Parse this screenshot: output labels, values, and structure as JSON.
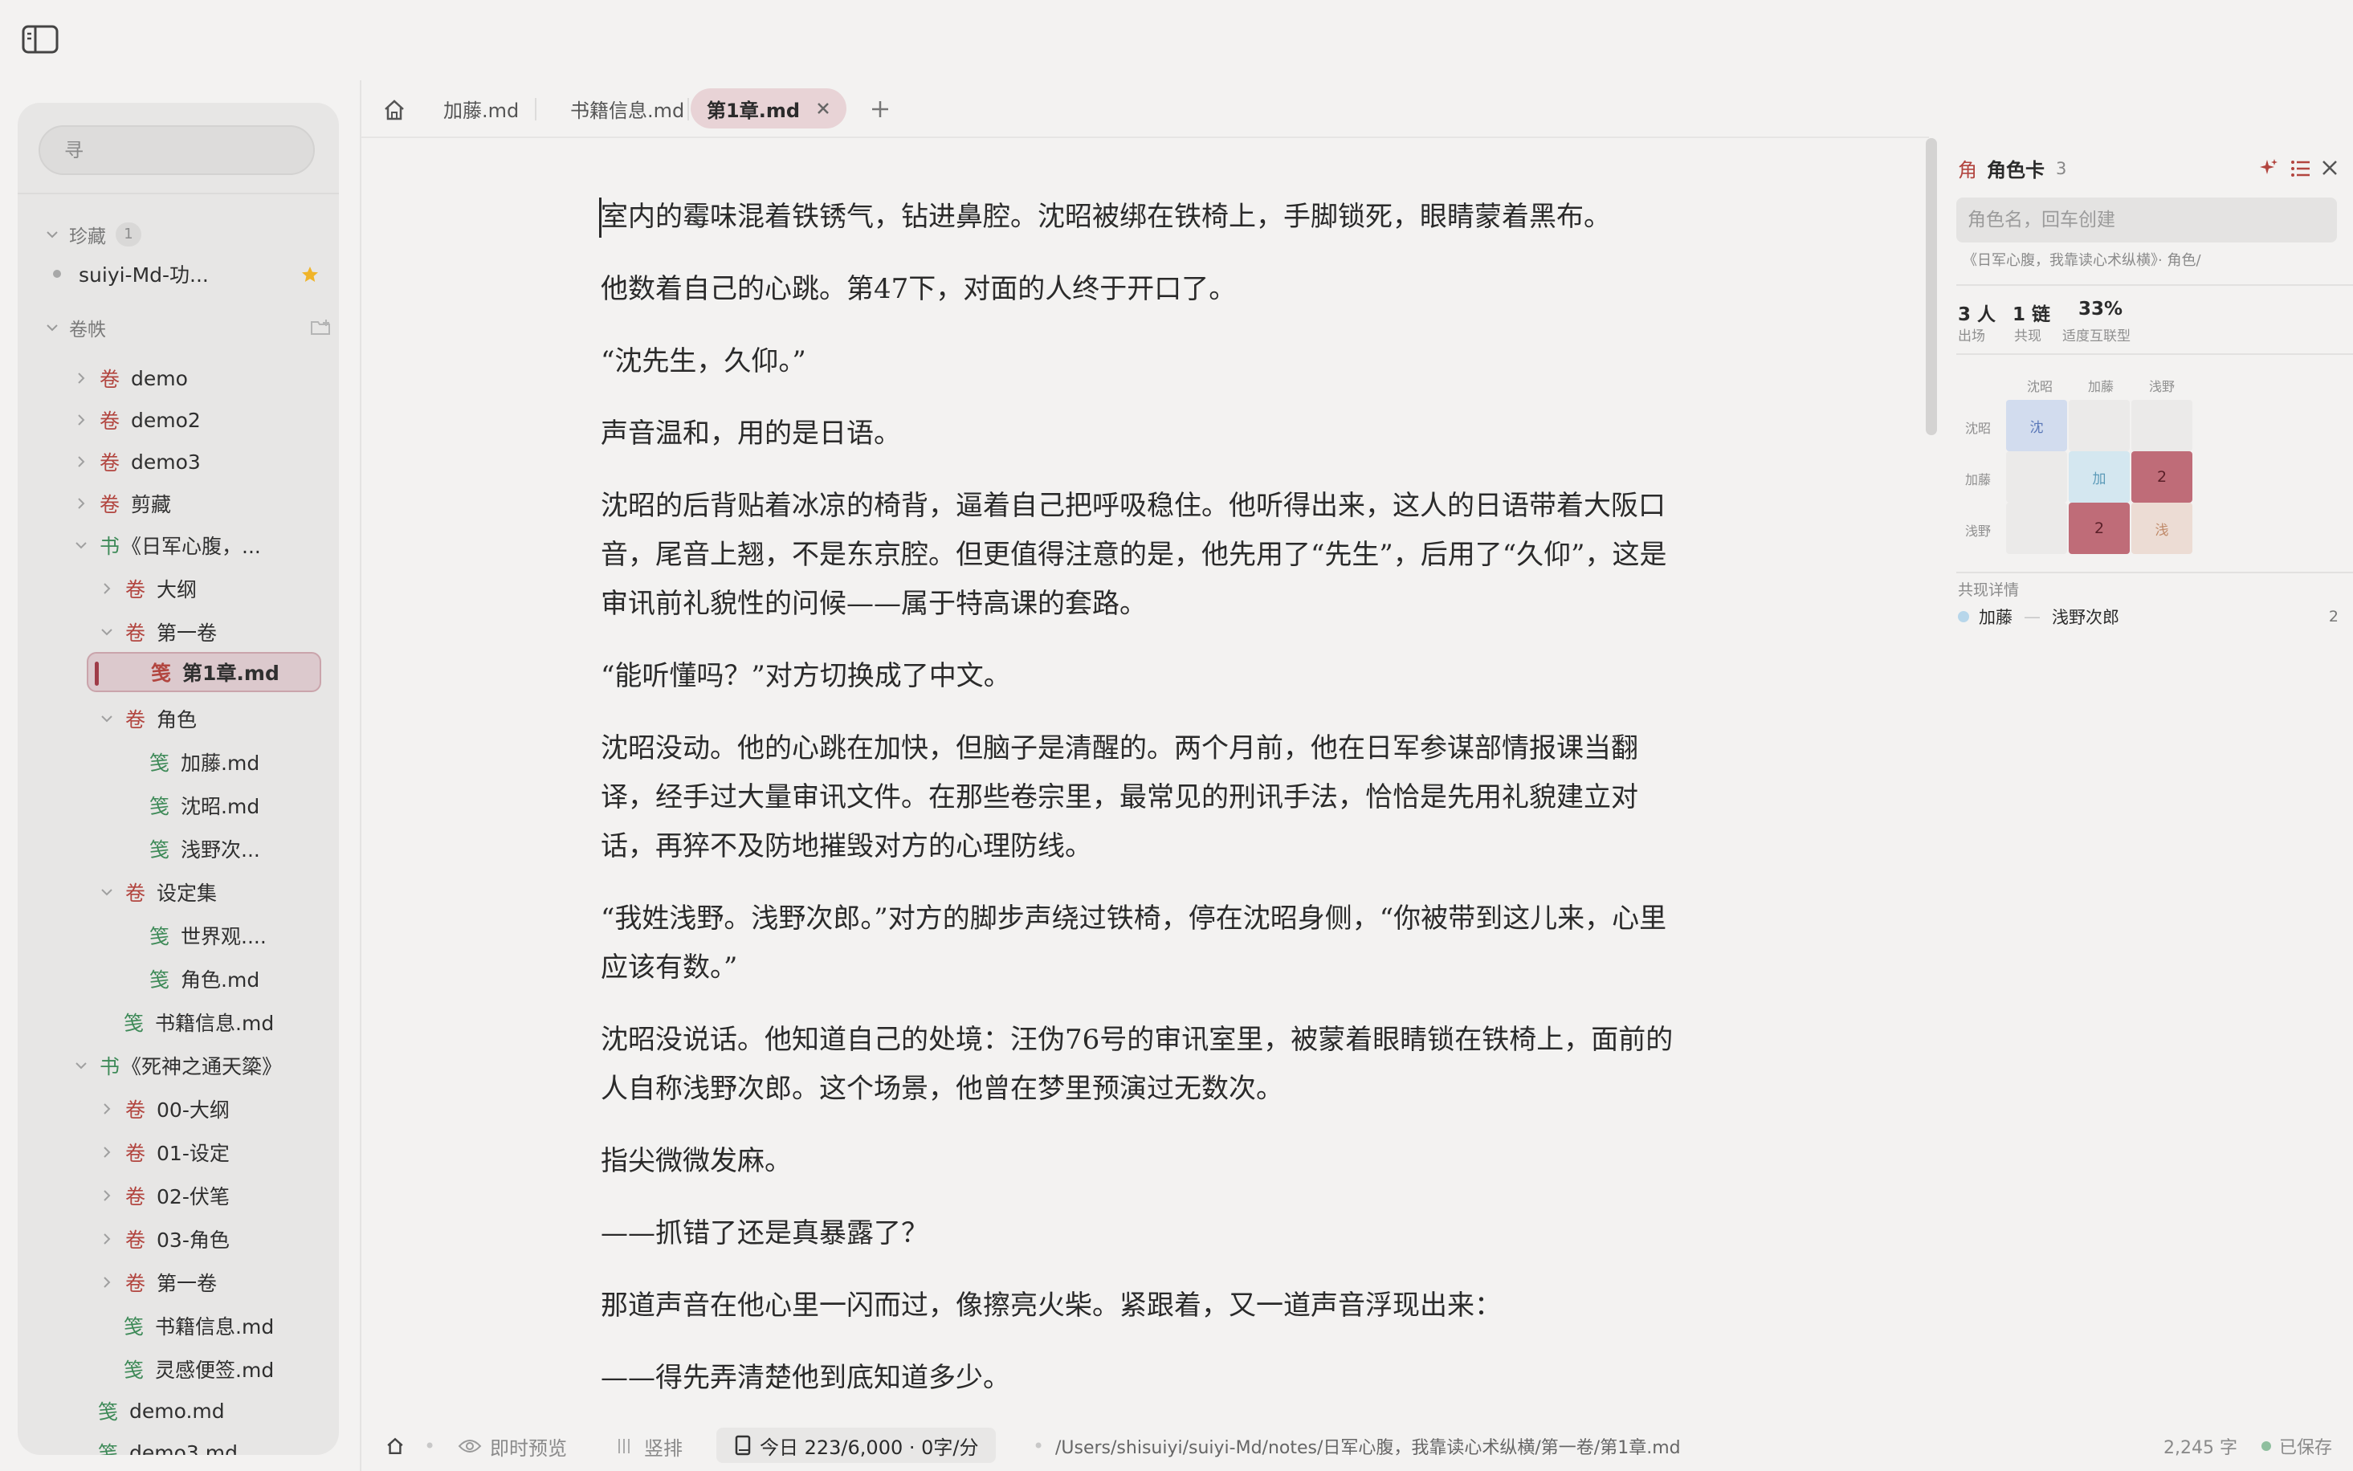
{
  "sidebar": {
    "search_placeholder": "寻",
    "favorites": {
      "label": "珍藏",
      "count": "1",
      "items": [
        {
          "label": "suiyi-Md-功..."
        }
      ]
    },
    "library": {
      "label": "卷帙",
      "items": [
        {
          "glyph": "卷",
          "label": "demo"
        },
        {
          "glyph": "卷",
          "label": "demo2"
        },
        {
          "glyph": "卷",
          "label": "demo3"
        },
        {
          "glyph": "卷",
          "label": "剪藏"
        },
        {
          "glyph": "书",
          "label": "《日军心腹，..."
        },
        {
          "glyph": "卷",
          "label": "大纲"
        },
        {
          "glyph": "卷",
          "label": "第一卷"
        },
        {
          "glyph": "笺",
          "label": "第1章.md"
        },
        {
          "glyph": "卷",
          "label": "角色"
        },
        {
          "glyph": "笺",
          "label": "加藤.md"
        },
        {
          "glyph": "笺",
          "label": "沈昭.md"
        },
        {
          "glyph": "笺",
          "label": "浅野次..."
        },
        {
          "glyph": "卷",
          "label": "设定集"
        },
        {
          "glyph": "笺",
          "label": "世界观...."
        },
        {
          "glyph": "笺",
          "label": "角色.md"
        },
        {
          "glyph": "笺",
          "label": "书籍信息.md"
        },
        {
          "glyph": "书",
          "label": "《死神之通天簗》"
        },
        {
          "glyph": "卷",
          "label": "00-大纲"
        },
        {
          "glyph": "卷",
          "label": "01-设定"
        },
        {
          "glyph": "卷",
          "label": "02-伏笔"
        },
        {
          "glyph": "卷",
          "label": "03-角色"
        },
        {
          "glyph": "卷",
          "label": "第一卷"
        },
        {
          "glyph": "笺",
          "label": "书籍信息.md"
        },
        {
          "glyph": "笺",
          "label": "灵感便签.md"
        },
        {
          "glyph": "笺",
          "label": "demo.md"
        },
        {
          "glyph": "笺",
          "label": "demo3.md"
        }
      ]
    }
  },
  "tabs": [
    {
      "label": "加藤.md"
    },
    {
      "label": "书籍信息.md"
    },
    {
      "label": "第1章.md"
    }
  ],
  "editor": {
    "paragraphs": [
      "室内的霉味混着铁锈气，钻进鼻腔。沈昭被绑在铁椅上，手脚锁死，眼睛蒙着黑布。",
      "他数着自己的心跳。第47下，对面的人终于开口了。",
      "“沈先生，久仰。”",
      "声音温和，用的是日语。",
      "沈昭的后背贴着冰凉的椅背，逼着自己把呼吸稳住。他听得出来，这人的日语带着大阪口音，尾音上翘，不是东京腔。但更值得注意的是，他先用了“先生”，后用了“久仰”，这是审讯前礼貌性的问候——属于特高课的套路。",
      "“能听懂吗？”对方切换成了中文。",
      "沈昭没动。他的心跳在加快，但脑子是清醒的。两个月前，他在日军参谋部情报课当翻译，经手过大量审讯文件。在那些卷宗里，最常见的刑讯手法，恰恰是先用礼貌建立对话，再猝不及防地摧毁对方的心理防线。",
      "“我姓浅野。浅野次郎。”对方的脚步声绕过铁椅，停在沈昭身侧，“你被带到这儿来，心里应该有数。”",
      "沈昭没说话。他知道自己的处境：汪伪76号的审讯室里，被蒙着眼睛锁在铁椅上，面前的人自称浅野次郎。这个场景，他曾在梦里预演过无数次。",
      "指尖微微发麻。",
      "——抓错了还是真暴露了？",
      "那道声音在他心里一闪而过，像擦亮火柴。紧跟着，又一道声音浮现出来：",
      "——得先弄清楚他到底知道多少。"
    ]
  },
  "panel": {
    "glyph": "角",
    "title": "角色卡",
    "count": "3",
    "input_placeholder": "角色名，回车创建",
    "path": "《日军心腹，我靠读心术纵横》· 角色/",
    "stats": [
      {
        "value": "3 人",
        "label": "出场"
      },
      {
        "value": "1 链",
        "label": "共现"
      },
      {
        "value": "33%",
        "label": "适度互联型"
      }
    ],
    "matrix": {
      "names": [
        "沈昭",
        "加藤",
        "浅野"
      ],
      "diag": [
        "沈",
        "加",
        "浅"
      ],
      "cooccur": "2"
    },
    "detail_title": "共现详情",
    "detail": {
      "a": "加藤",
      "dash": "—",
      "b": "浅野次郎",
      "count": "2"
    }
  },
  "status": {
    "preview": "即时预览",
    "vertical": "竖排",
    "today": "今日 223/6,000 · 0字/分",
    "path": "/Users/shisuiyi/suiyi-Md/notes/日军心腹，我靠读心术纵横/第一卷/第1章.md",
    "words": "2,245 字",
    "saved": "已保存"
  },
  "colors": {
    "accent": "#9f3b47",
    "volume": "#b2453f",
    "note": "#3e8a58",
    "matrix_strong": "#bf6c78",
    "star": "#f0b429"
  }
}
